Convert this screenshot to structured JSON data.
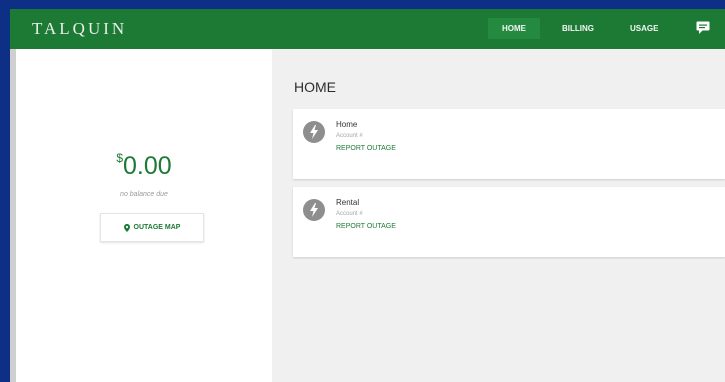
{
  "header": {
    "brand": "TALQUIN",
    "nav": [
      {
        "label": "HOME"
      },
      {
        "label": "BILLING"
      },
      {
        "label": "USAGE"
      }
    ],
    "chat_icon": "chat-bubble-icon"
  },
  "sidebar": {
    "balance_currency": "$",
    "balance_amount": "0.00",
    "balance_caption": "no balance due",
    "outage_map_label": "OUTAGE MAP",
    "outage_map_icon": "map-pin-icon"
  },
  "main": {
    "title": "HOME",
    "accounts": [
      {
        "name": "Home",
        "sub": "Account #",
        "link": "REPORT OUTAGE",
        "icon": "lightning-icon"
      },
      {
        "name": "Rental",
        "sub": "Account #",
        "link": "REPORT OUTAGE",
        "icon": "lightning-icon"
      }
    ]
  },
  "colors": {
    "brand_green": "#1d7a35",
    "outer_blue": "#0e2f86"
  }
}
